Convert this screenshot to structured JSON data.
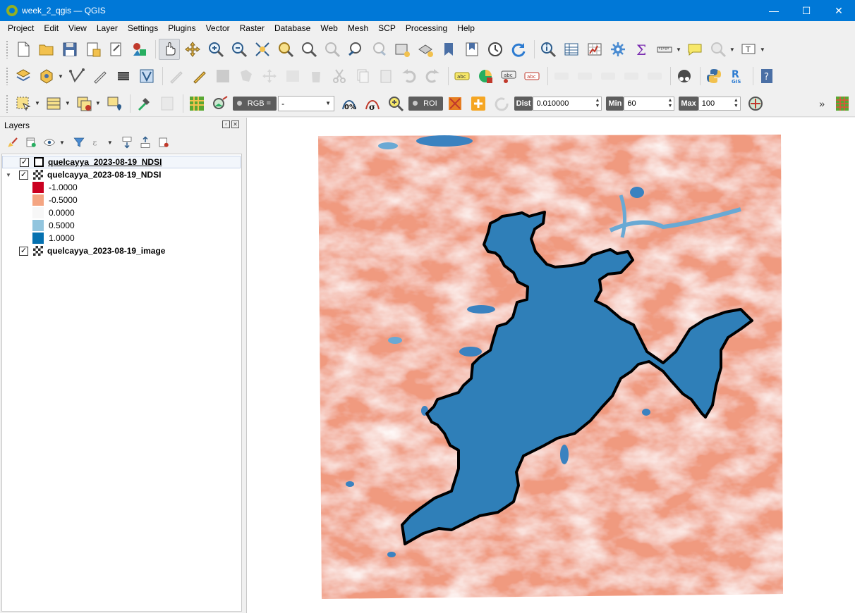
{
  "window": {
    "title": "week_2_qgis — QGIS",
    "minimize": "—",
    "maximize": "☐",
    "close": "✕"
  },
  "menu": [
    "Project",
    "Edit",
    "View",
    "Layer",
    "Settings",
    "Plugins",
    "Vector",
    "Raster",
    "Database",
    "Web",
    "Mesh",
    "SCP",
    "Processing",
    "Help"
  ],
  "scp_toolbar": {
    "rgb_label": "RGB =",
    "rgb_value": "-",
    "roi_label": "ROI",
    "dist_label": "Dist",
    "dist_value": "0.010000",
    "min_label": "Min",
    "min_value": "60",
    "max_label": "Max",
    "max_value": "100",
    "overflow": "»"
  },
  "layers_panel": {
    "title": "Layers",
    "layers": [
      {
        "name": "quelcayya_2023-08-19_NDSI",
        "type": "vector",
        "checked": true,
        "selected": true
      },
      {
        "name": "quelcayya_2023-08-19_NDSI",
        "type": "raster",
        "checked": true,
        "expanded": true,
        "legend": [
          {
            "label": "-1.0000",
            "color": "#ca0020"
          },
          {
            "label": "-0.5000",
            "color": "#f4a582"
          },
          {
            "label": "0.0000",
            "color": "#f7f7f7"
          },
          {
            "label": "0.5000",
            "color": "#92c5de"
          },
          {
            "label": "1.0000",
            "color": "#0571b0"
          }
        ]
      },
      {
        "name": "quelcayya_2023-08-19_image",
        "type": "raster",
        "checked": true
      }
    ]
  },
  "map": {
    "ice_color": "#2f7fb8",
    "outline_color": "#000000",
    "ground_color": "#f09a7f"
  }
}
